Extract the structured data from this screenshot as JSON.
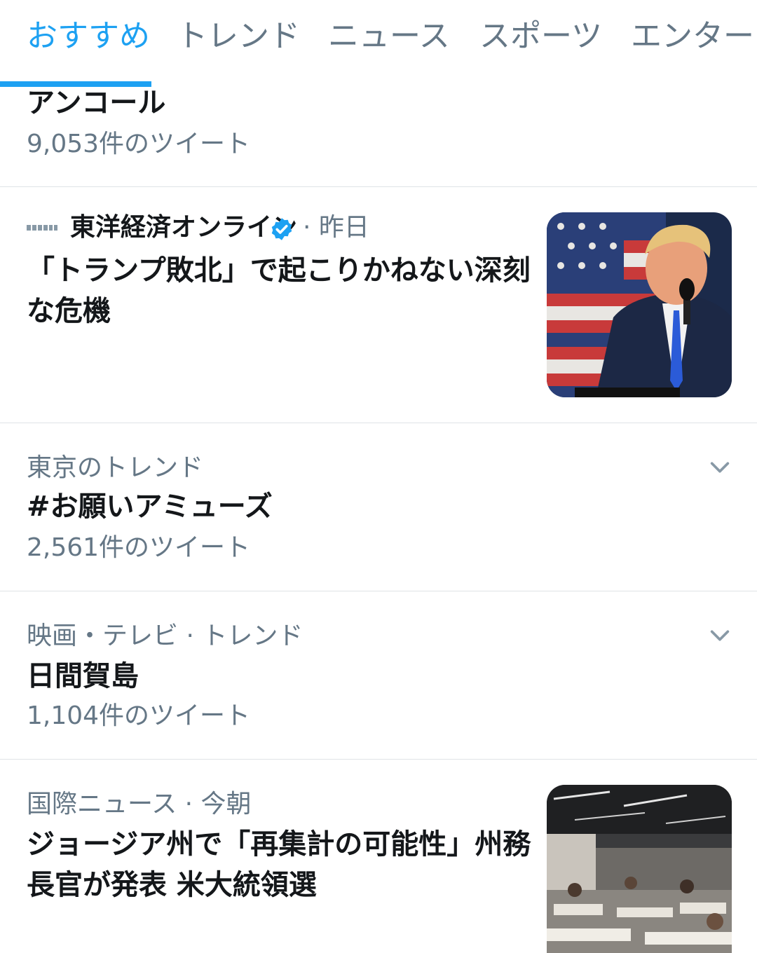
{
  "tabs": [
    {
      "label": "おすすめ",
      "active": true
    },
    {
      "label": "トレンド",
      "active": false
    },
    {
      "label": "ニュース",
      "active": false
    },
    {
      "label": "スポーツ",
      "active": false
    },
    {
      "label": "エンターテ",
      "active": false
    }
  ],
  "accent_color": "#1da1f2",
  "trend_top": {
    "title": "アンコール",
    "count": "9,053件のツイート"
  },
  "news_1": {
    "source_logo_text": "東洋経済ONLINE",
    "source": "東洋経済オンライン",
    "verified_icon": "verified-badge-icon",
    "time": "· 昨日",
    "headline": "「トランプ敗北」で起こりかねない深刻な危機",
    "thumbnail_icon": "news-photo-icon"
  },
  "trend_2": {
    "category": "東京のトレンド",
    "title": "#お願いアミューズ",
    "count": "2,561件のツイート",
    "menu_icon": "chevron-down-icon"
  },
  "trend_3": {
    "category": "映画・テレビ · トレンド",
    "title": "日間賀島",
    "count": "1,104件のツイート",
    "menu_icon": "chevron-down-icon"
  },
  "news_2": {
    "meta": "国際ニュース · 今朝",
    "headline": "ジョージア州で「再集計の可能性」州務長官が発表 米大統領選",
    "thumbnail_icon": "news-photo-icon"
  }
}
